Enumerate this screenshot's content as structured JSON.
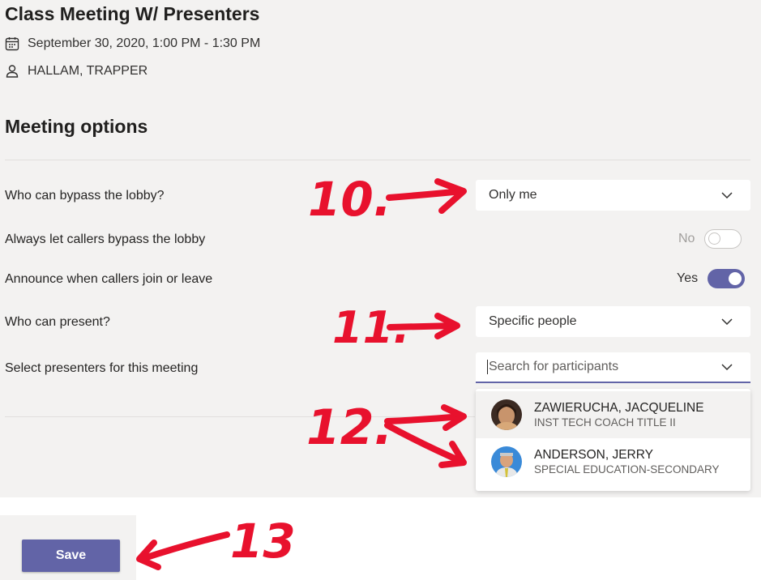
{
  "meeting": {
    "title": "Class Meeting W/ Presenters",
    "datetime": "September 30, 2020, 1:00 PM - 1:30 PM",
    "organizer": "HALLAM, TRAPPER"
  },
  "options": {
    "heading": "Meeting options",
    "bypass_lobby": {
      "label": "Who can bypass the lobby?",
      "value": "Only me"
    },
    "callers_bypass": {
      "label": "Always let callers bypass the lobby",
      "state_label": "No",
      "checked": false
    },
    "announce_callers": {
      "label": "Announce when callers join or leave",
      "state_label": "Yes",
      "checked": true
    },
    "who_can_present": {
      "label": "Who can present?",
      "value": "Specific people"
    },
    "select_presenters": {
      "label": "Select presenters for this meeting",
      "placeholder": "Search for participants"
    }
  },
  "people": [
    {
      "name": "ZAWIERUCHA, JACQUELINE",
      "title": "INST TECH COACH TITLE II"
    },
    {
      "name": "ANDERSON, JERRY",
      "title": "SPECIAL EDUCATION-SECONDARY"
    }
  ],
  "save_label": "Save",
  "annotations": {
    "a10": "10.",
    "a11": "11.",
    "a12": "12.",
    "a13": "13"
  },
  "colors": {
    "accent": "#6264a7",
    "annotation": "#e8112d",
    "panel": "#f3f2f1"
  },
  "icons": {
    "calendar": "calendar-icon",
    "organizer": "person-icon",
    "dropdown": "chevron-down-icon"
  }
}
